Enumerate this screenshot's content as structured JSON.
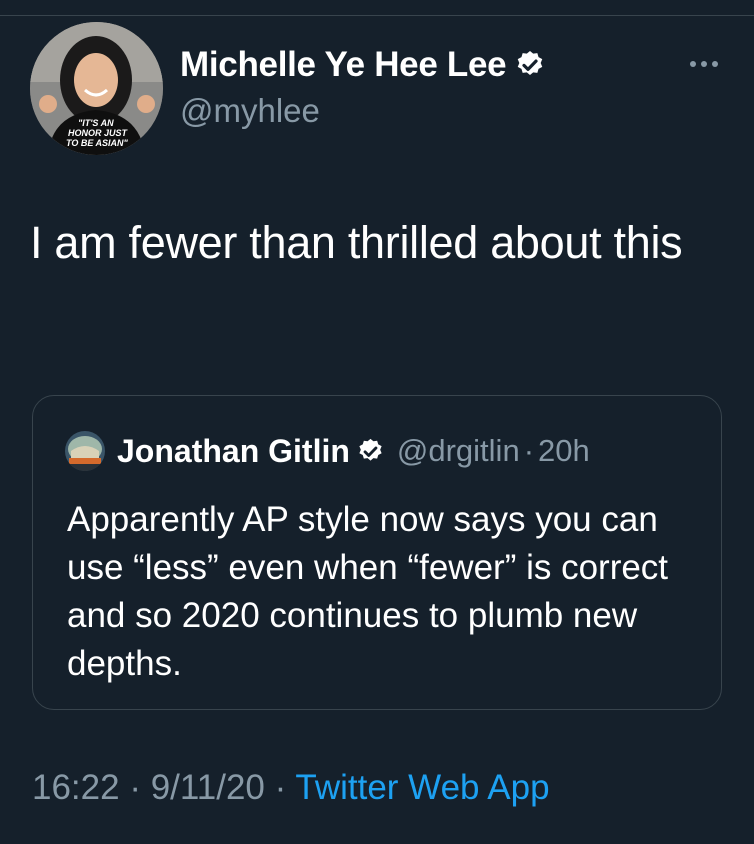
{
  "tweet": {
    "author_name": "Michelle Ye Hee Lee",
    "author_handle": "@myhlee",
    "avatar_shirt_text": "\"IT'S AN HONOR JUST TO BE ASIAN\"",
    "text": "I am fewer than thrilled about this",
    "time": "16:22",
    "date": "9/11/20",
    "source": "Twitter Web App",
    "separator": "·"
  },
  "quote": {
    "author_name": "Jonathan Gitlin",
    "author_handle": "@drgitlin",
    "separator": "·",
    "time_ago": "20h",
    "text": "Apparently AP style now says you can use “less” even when “fewer” is correct and so 2020 continues to plumb new depths."
  },
  "colors": {
    "background": "#15202b",
    "text": "#ffffff",
    "secondary_text": "#8899a6",
    "accent": "#1da1f2",
    "border": "#38444d",
    "verified": "#ffffff"
  },
  "icons": {
    "verified": "verified-badge-icon",
    "more": "more-options-icon"
  }
}
